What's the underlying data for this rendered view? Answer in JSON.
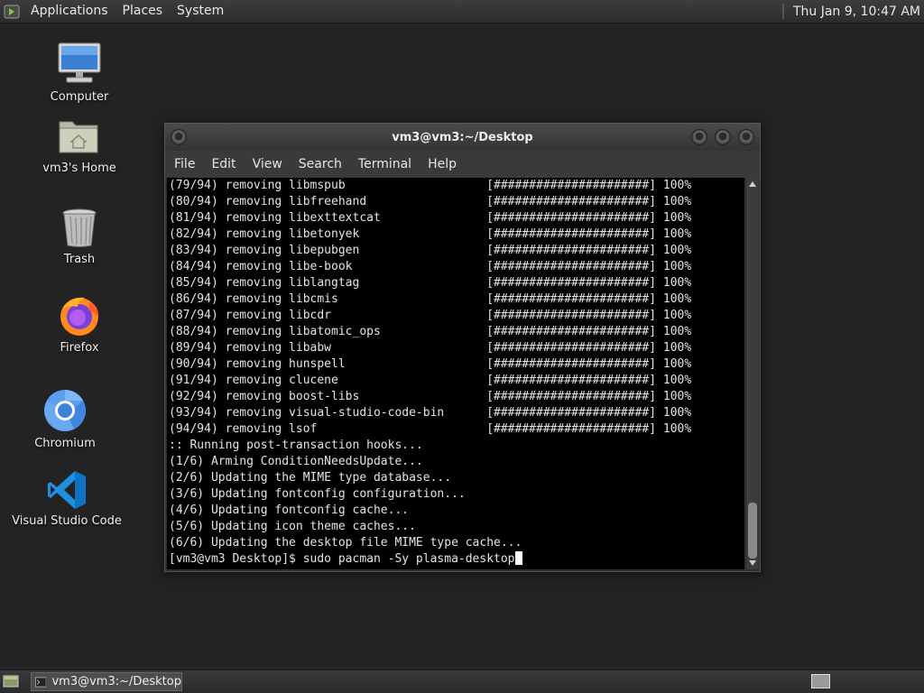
{
  "top_panel": {
    "menus": [
      "Applications",
      "Places",
      "System"
    ],
    "clock": "Thu Jan  9, 10:47 AM"
  },
  "desktop_icons": [
    {
      "label": "Computer",
      "icon": "computer-icon"
    },
    {
      "label": "vm3's Home",
      "icon": "home-folder-icon"
    },
    {
      "label": "Trash",
      "icon": "trash-icon"
    },
    {
      "label": "Firefox",
      "icon": "firefox-icon"
    },
    {
      "label": "Chromium",
      "icon": "chromium-icon"
    },
    {
      "label": "Visual Studio Code",
      "icon": "vscode-icon"
    }
  ],
  "terminal": {
    "title": "vm3@vm3:~/Desktop",
    "menu": [
      "File",
      "Edit",
      "View",
      "Search",
      "Terminal",
      "Help"
    ],
    "lines": [
      "(79/94) removing libmspub                    [######################] 100%",
      "(80/94) removing libfreehand                 [######################] 100%",
      "(81/94) removing libexttextcat               [######################] 100%",
      "(82/94) removing libetonyek                  [######################] 100%",
      "(83/94) removing libepubgen                  [######################] 100%",
      "(84/94) removing libe-book                   [######################] 100%",
      "(85/94) removing liblangtag                  [######################] 100%",
      "(86/94) removing libcmis                     [######################] 100%",
      "(87/94) removing libcdr                      [######################] 100%",
      "(88/94) removing libatomic_ops               [######################] 100%",
      "(89/94) removing libabw                      [######################] 100%",
      "(90/94) removing hunspell                    [######################] 100%",
      "(91/94) removing clucene                     [######################] 100%",
      "(92/94) removing boost-libs                  [######################] 100%",
      "(93/94) removing visual-studio-code-bin      [######################] 100%",
      "(94/94) removing lsof                        [######################] 100%",
      ":: Running post-transaction hooks...",
      "(1/6) Arming ConditionNeedsUpdate...",
      "(2/6) Updating the MIME type database...",
      "(3/6) Updating fontconfig configuration...",
      "(4/6) Updating fontconfig cache...",
      "(5/6) Updating icon theme caches...",
      "(6/6) Updating the desktop file MIME type cache..."
    ],
    "prompt": "[vm3@vm3 Desktop]$ sudo pacman -Sy plasma-desktop"
  },
  "bottom_panel": {
    "task": "vm3@vm3:~/Desktop"
  },
  "colors": {
    "desktop_bg": "#232323",
    "terminal_bg": "#000000",
    "terminal_fg": "#e4e4e4"
  }
}
